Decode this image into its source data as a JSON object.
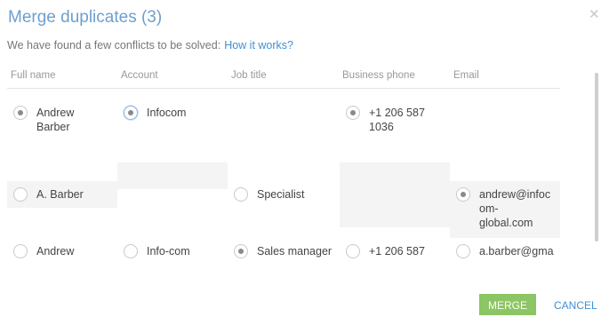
{
  "dialog": {
    "title": "Merge duplicates (3)",
    "subtitle": "We have found a few conflicts to be solved:",
    "help_link": "How it works?",
    "close_icon": "close-icon"
  },
  "columns": [
    "Full name",
    "Account",
    "Job title",
    "Business phone",
    "Email"
  ],
  "rows": [
    {
      "cells": [
        {
          "value": "Andrew\nBarber",
          "selected": true
        },
        {
          "value": "Infocom",
          "selected": true,
          "focused": true
        },
        {
          "value": ""
        },
        {
          "value": "+1 206 587\n1036",
          "selected": true
        },
        {
          "value": ""
        }
      ]
    },
    {
      "cells": [
        {
          "value": "A. Barber",
          "selected": false
        },
        {
          "value": ""
        },
        {
          "value": "Specialist",
          "selected": false
        },
        {
          "value": ""
        },
        {
          "value": "andrew@infoc\nom-\nglobal.com",
          "selected": true
        }
      ]
    },
    {
      "cells": [
        {
          "value": "Andrew",
          "selected": false
        },
        {
          "value": "Info-com",
          "selected": false
        },
        {
          "value": "Sales manager",
          "selected": true
        },
        {
          "value": "+1 206 587",
          "selected": false
        },
        {
          "value": "a.barber@gma",
          "selected": false
        }
      ]
    }
  ],
  "actions": {
    "merge": "MERGE",
    "cancel": "CANCEL"
  },
  "colors": {
    "accent_blue": "#3f8fd6",
    "title_blue": "#6e9fd0",
    "merge_green": "#8cc563",
    "shade": "#f4f4f4"
  }
}
